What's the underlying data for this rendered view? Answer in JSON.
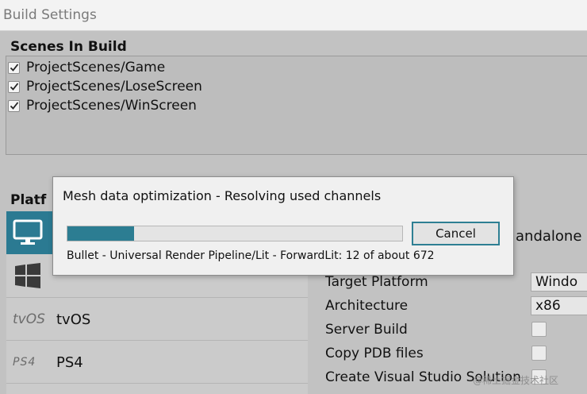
{
  "window": {
    "title": "Build Settings"
  },
  "scenes": {
    "header": "Scenes In Build",
    "items": [
      {
        "label": "ProjectScenes/Game",
        "checked": true
      },
      {
        "label": "ProjectScenes/LoseScreen",
        "checked": true
      },
      {
        "label": "ProjectScenes/WinScreen",
        "checked": true
      }
    ]
  },
  "platform": {
    "header": "Platf",
    "items": [
      {
        "name": "",
        "icon": "monitor-icon",
        "selected": true
      },
      {
        "name": "",
        "icon": "windows-icon",
        "selected": false
      },
      {
        "tag": "tvOS",
        "name": "tvOS",
        "icon": "tvos-icon",
        "selected": false
      },
      {
        "tag": "PS4",
        "name": "PS4",
        "icon": "ps4-icon",
        "selected": false
      }
    ]
  },
  "settings": {
    "title_fragment": "andalone",
    "target_platform": {
      "label": "Target Platform",
      "value": "Windo"
    },
    "architecture": {
      "label": "Architecture",
      "value": "x86"
    },
    "server_build": {
      "label": "Server Build"
    },
    "copy_pdb": {
      "label": "Copy PDB files"
    },
    "create_vs": {
      "label": "Create Visual Studio Solution"
    }
  },
  "dialog": {
    "title": "Mesh data optimization - Resolving used channels",
    "progress": 0.2,
    "cancel_label": "Cancel",
    "status": "Bullet - Universal Render Pipeline/Lit - ForwardLit: 12 of about 672",
    "accent": "#2c7d92"
  },
  "watermark": "@稀土掘金技术社区"
}
